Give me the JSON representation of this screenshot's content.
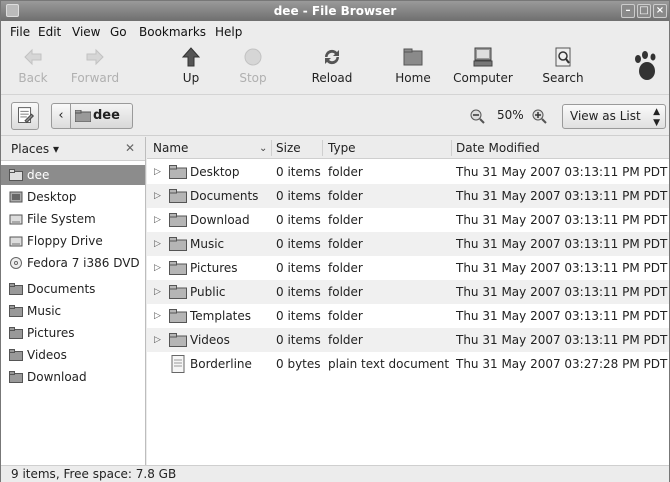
{
  "window": {
    "title": "dee - File Browser"
  },
  "menu": [
    "File",
    "Edit",
    "View",
    "Go",
    "Bookmarks",
    "Help"
  ],
  "toolbar": {
    "back": "Back",
    "forward": "Forward",
    "up": "Up",
    "stop": "Stop",
    "reload": "Reload",
    "home": "Home",
    "computer": "Computer",
    "search": "Search"
  },
  "location": {
    "current": "dee",
    "zoom": "50%",
    "view_mode": "View as List"
  },
  "sidebar": {
    "header": "Places",
    "items": [
      {
        "label": "dee",
        "icon": "home-folder-icon"
      },
      {
        "label": "Desktop",
        "icon": "desktop-icon"
      },
      {
        "label": "File System",
        "icon": "drive-icon"
      },
      {
        "label": "Floppy Drive",
        "icon": "floppy-icon"
      },
      {
        "label": "Fedora 7 i386 DVD",
        "icon": "dvd-icon"
      },
      {
        "label": "Documents",
        "icon": "folder-icon"
      },
      {
        "label": "Music",
        "icon": "folder-icon"
      },
      {
        "label": "Pictures",
        "icon": "folder-icon"
      },
      {
        "label": "Videos",
        "icon": "folder-icon"
      },
      {
        "label": "Download",
        "icon": "folder-icon"
      }
    ]
  },
  "list": {
    "columns": [
      "Name",
      "Size",
      "Type",
      "Date Modified"
    ],
    "rows": [
      {
        "name": "Desktop",
        "size": "0 items",
        "type": "folder",
        "date": "Thu 31 May 2007 03:13:11 PM PDT"
      },
      {
        "name": "Documents",
        "size": "0 items",
        "type": "folder",
        "date": "Thu 31 May 2007 03:13:11 PM PDT"
      },
      {
        "name": "Download",
        "size": "0 items",
        "type": "folder",
        "date": "Thu 31 May 2007 03:13:11 PM PDT"
      },
      {
        "name": "Music",
        "size": "0 items",
        "type": "folder",
        "date": "Thu 31 May 2007 03:13:11 PM PDT"
      },
      {
        "name": "Pictures",
        "size": "0 items",
        "type": "folder",
        "date": "Thu 31 May 2007 03:13:11 PM PDT"
      },
      {
        "name": "Public",
        "size": "0 items",
        "type": "folder",
        "date": "Thu 31 May 2007 03:13:11 PM PDT"
      },
      {
        "name": "Templates",
        "size": "0 items",
        "type": "folder",
        "date": "Thu 31 May 2007 03:13:11 PM PDT"
      },
      {
        "name": "Videos",
        "size": "0 items",
        "type": "folder",
        "date": "Thu 31 May 2007 03:13:11 PM PDT"
      },
      {
        "name": "Borderline",
        "size": "0 bytes",
        "type": "plain text document",
        "date": "Thu 31 May 2007 03:27:28 PM PDT"
      }
    ]
  },
  "status": "9 items, Free space: 7.8 GB"
}
